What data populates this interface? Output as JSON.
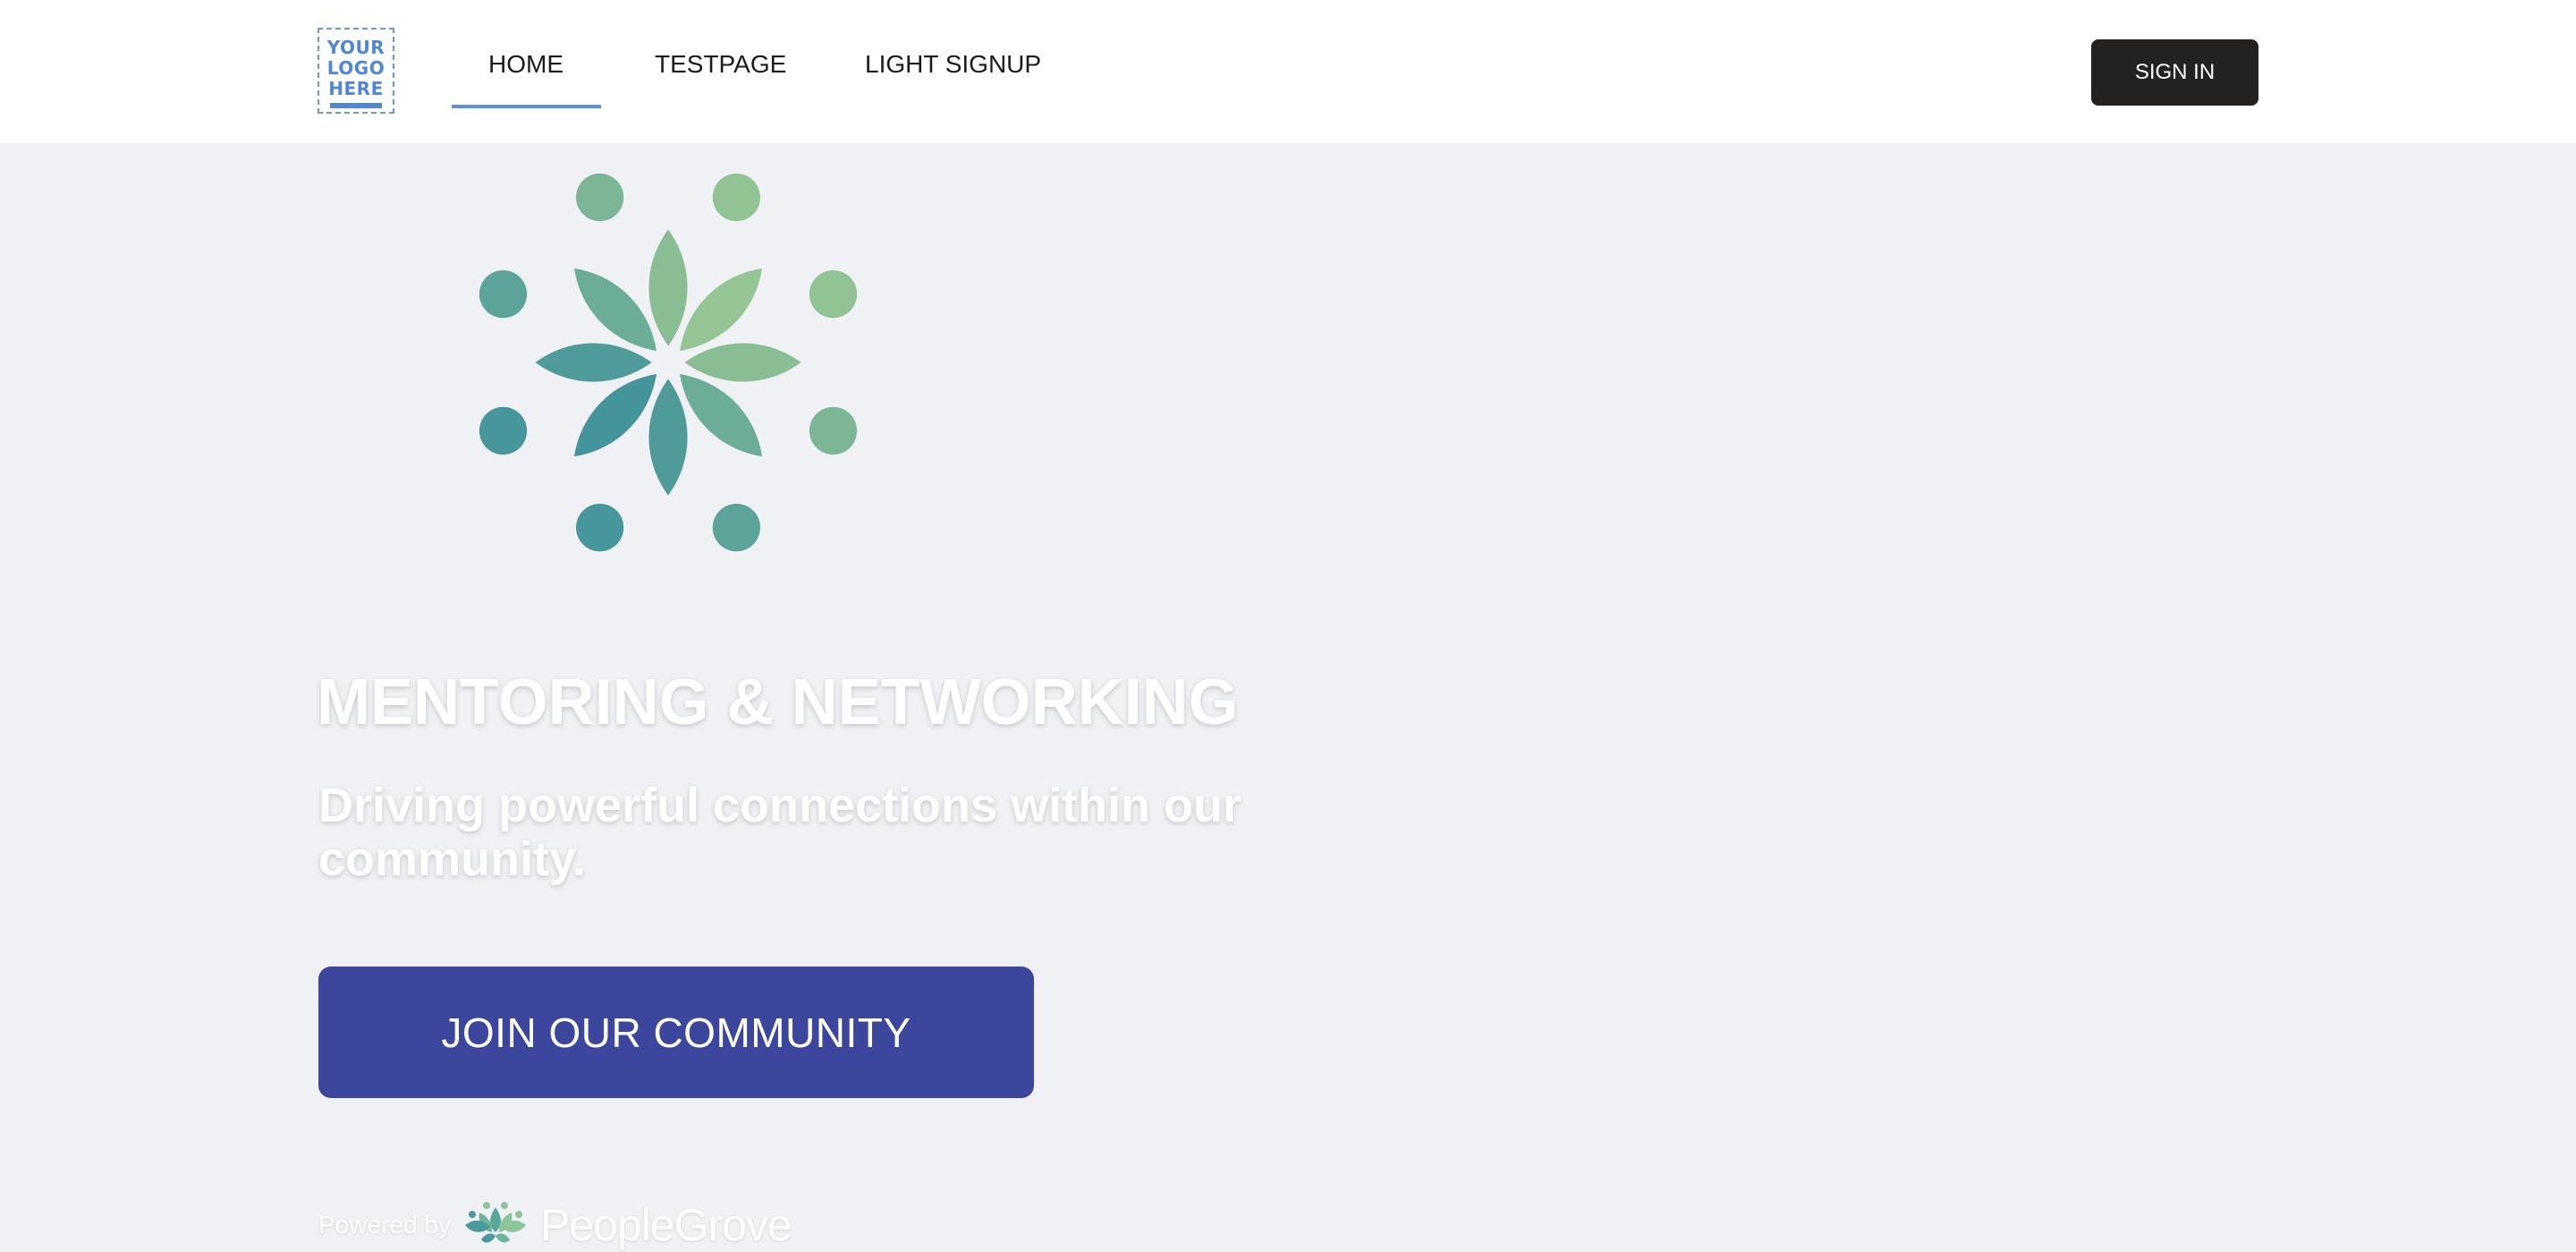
{
  "header": {
    "logo_lines": [
      "YOUR",
      "LOGO",
      "HERE"
    ],
    "nav": [
      {
        "label": "HOME",
        "active": true
      },
      {
        "label": "TESTPAGE",
        "active": false
      },
      {
        "label": "LIGHT SIGNUP",
        "active": false
      }
    ],
    "signin_label": "SIGN IN"
  },
  "hero": {
    "title": "MENTORING & NETWORKING",
    "subtitle": "Driving powerful connections within our community.",
    "cta_label": "JOIN OUR COMMUNITY",
    "emblem_icon": "flower-emblem-icon"
  },
  "footer": {
    "powered_by": "Powered by",
    "brand": "PeopleGrove",
    "brand_icon": "peoplegrove-logo-icon"
  },
  "colors": {
    "background": "#f0f1f4",
    "header_bg": "#ffffff",
    "nav_active_underline": "#5f8ee0",
    "signin_bg": "#232220",
    "cta_bg": "#3d469d",
    "logo_blue": "#4f86d8",
    "emblem_light": "#95c594",
    "emblem_dark": "#43949b"
  }
}
